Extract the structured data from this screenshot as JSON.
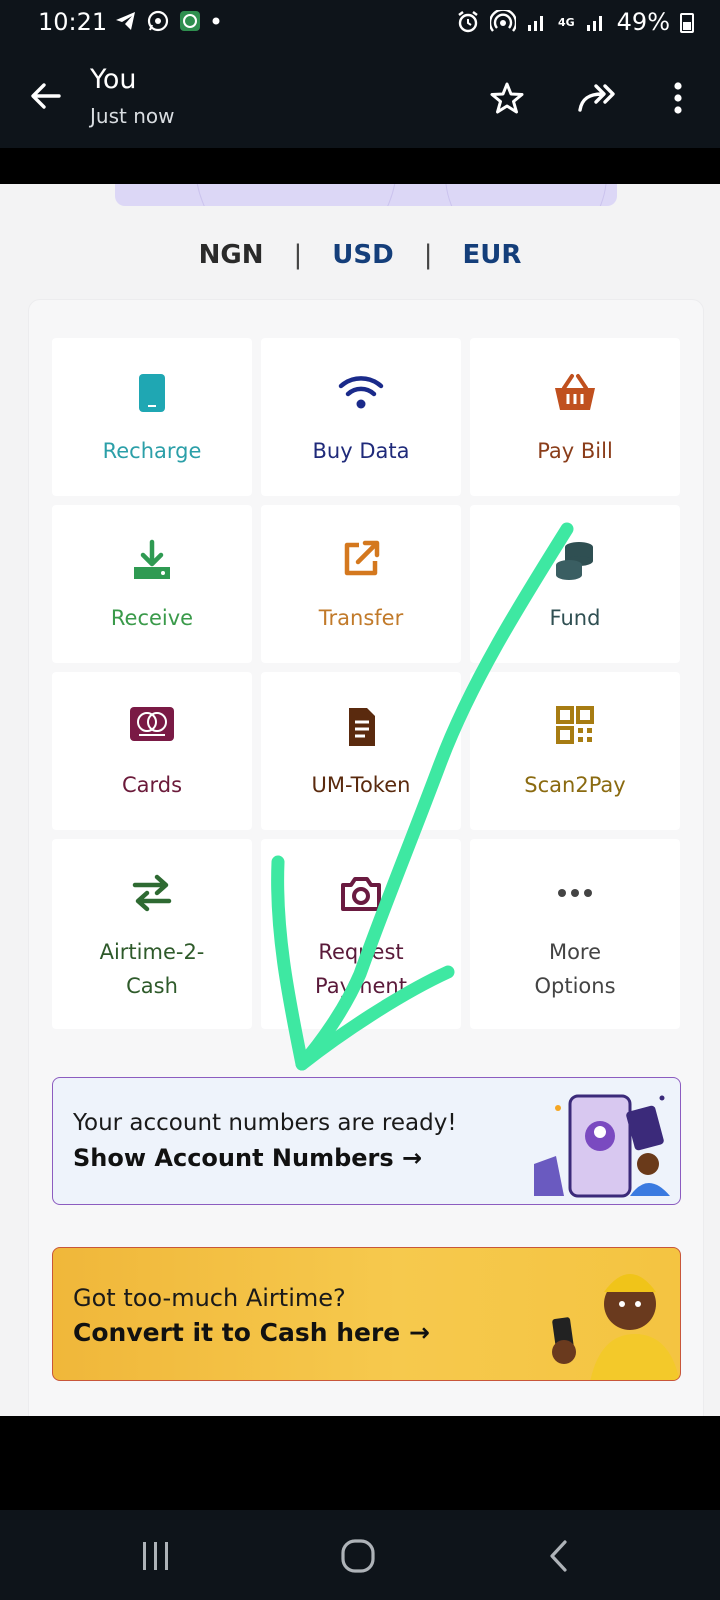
{
  "status_bar": {
    "time": "10:21",
    "network": "4G",
    "battery": "49%"
  },
  "app_bar": {
    "title": "You",
    "subtitle": "Just now"
  },
  "currency": {
    "options": [
      "NGN",
      "USD",
      "EUR"
    ],
    "selected": "NGN",
    "separator": "|"
  },
  "tiles": [
    {
      "label": "Recharge",
      "icon": "phone-icon",
      "color": "#2b9fa8"
    },
    {
      "label": "Buy Data",
      "icon": "wifi-icon",
      "color": "#1f2a7a"
    },
    {
      "label": "Pay Bill",
      "icon": "basket-icon",
      "color": "#8a3d1a"
    },
    {
      "label": "Receive",
      "icon": "download-icon",
      "color": "#3a9a4a"
    },
    {
      "label": "Transfer",
      "icon": "external-link-icon",
      "color": "#c17a2a"
    },
    {
      "label": "Fund",
      "icon": "coins-icon",
      "color": "#2f4f52"
    },
    {
      "label": "Cards",
      "icon": "mastercard-icon",
      "color": "#6b1a3a"
    },
    {
      "label": "UM-Token",
      "icon": "token-icon",
      "color": "#5a2a0e"
    },
    {
      "label": "Scan2Pay",
      "icon": "qr-code-icon",
      "color": "#8a6a10"
    },
    {
      "label": "Airtime-2-Cash",
      "icon": "swap-arrows-icon",
      "color": "#2e5a2a"
    },
    {
      "label": "Request Payment",
      "icon": "camera-icon",
      "color": "#5a1a3a"
    },
    {
      "label": "More Options",
      "icon": "more-dots-icon",
      "color": "#444444"
    }
  ],
  "banner_account": {
    "line1": "Your account numbers are ready!",
    "line2": "Show Account Numbers →"
  },
  "banner_airtime": {
    "line1": "Got too-much Airtime?",
    "line2": "Convert it to Cash here →"
  },
  "colors": {
    "annotation_stroke": "#3ee8a2"
  }
}
